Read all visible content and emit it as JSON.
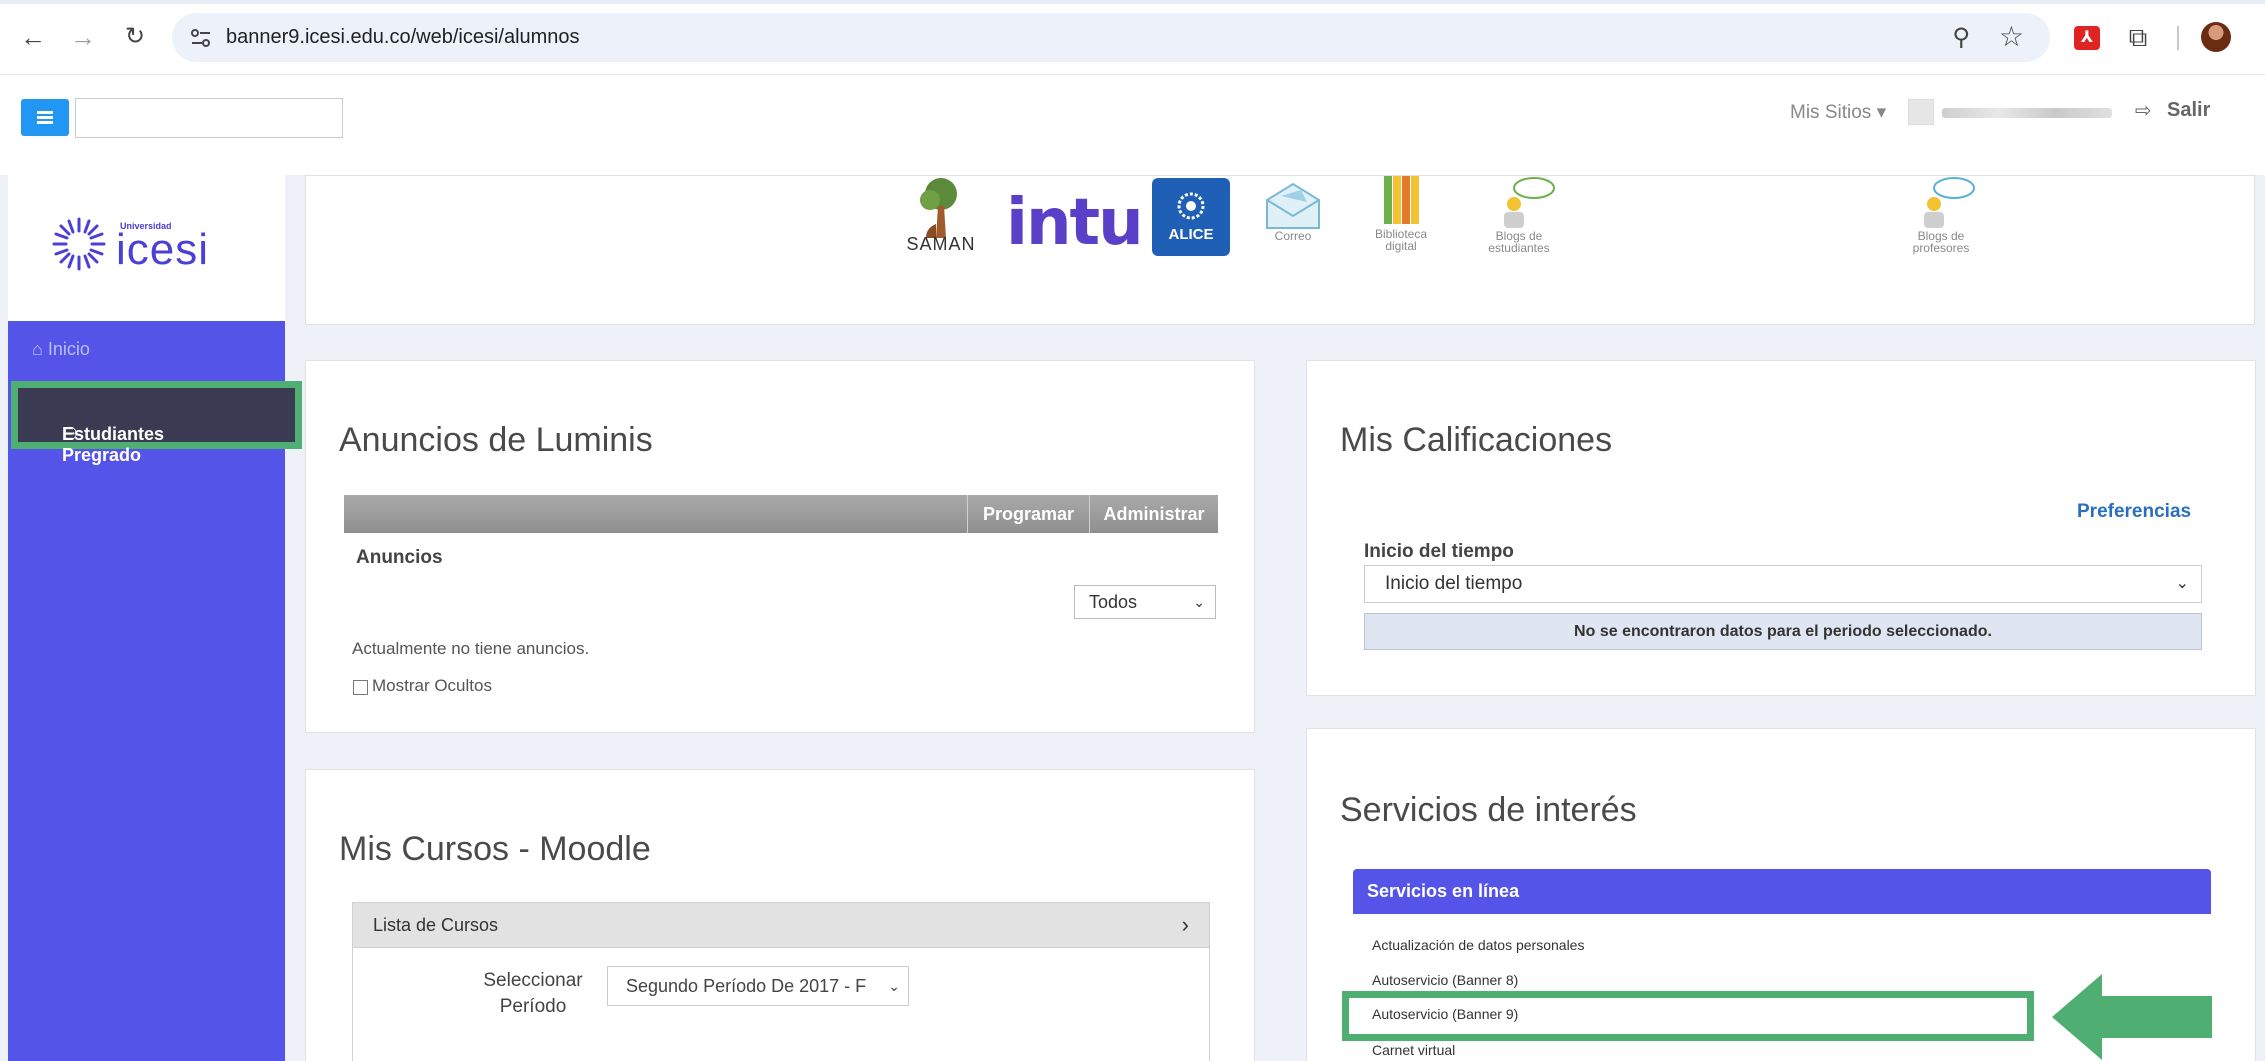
{
  "browser": {
    "url": "banner9.icesi.edu.co/web/icesi/alumnos"
  },
  "header": {
    "mis_sitios": "Mis Sitios ▾",
    "salir": "Salir"
  },
  "logo": {
    "small": "Universidad",
    "name": "icesi"
  },
  "sidebar": {
    "items": [
      {
        "label": "Inicio"
      },
      {
        "label": "Estudiantes Pregrado"
      }
    ]
  },
  "shortcuts": [
    {
      "label": "SAMAN",
      "icon": "saman-tree-icon"
    },
    {
      "label": "intu",
      "icon": "intu-logo"
    },
    {
      "label": "ALICE",
      "icon": "alice-icon"
    },
    {
      "label": "Correo",
      "icon": "mail-icon"
    },
    {
      "label": "Biblioteca digital",
      "icon": "books-icon"
    },
    {
      "label": "Blogs de estudiantes",
      "icon": "blog-students-icon"
    },
    {
      "label": "Blogs de profesores",
      "icon": "blog-teachers-icon"
    }
  ],
  "anuncios": {
    "title": "Anuncios de Luminis",
    "btn_programar": "Programar",
    "btn_administrar": "Administrar",
    "subtitle": "Anuncios",
    "filter": "Todos",
    "empty": "Actualmente no tiene anuncios.",
    "mostrar_ocultos": "Mostrar Ocultos"
  },
  "calificaciones": {
    "title": "Mis Calificaciones",
    "preferencias": "Preferencias",
    "label": "Inicio del tiempo",
    "select": "Inicio del tiempo",
    "message": "No se encontraron datos para el periodo seleccionado."
  },
  "cursos": {
    "title": "Mis Cursos - Moodle",
    "lista": "Lista de Cursos",
    "periodo_label": "Seleccionar Período",
    "periodo_value": "Segundo Período De 2017 - F"
  },
  "servicios": {
    "title": "Servicios de interés",
    "section": "Servicios en línea",
    "items": [
      "Actualización de datos personales",
      "Autoservicio (Banner 8)",
      "Autoservicio (Banner 9)",
      "Carnet virtual"
    ]
  },
  "colors": {
    "accent": "#5454e8",
    "highlight": "#4fae72",
    "menu": "#2196f3"
  }
}
